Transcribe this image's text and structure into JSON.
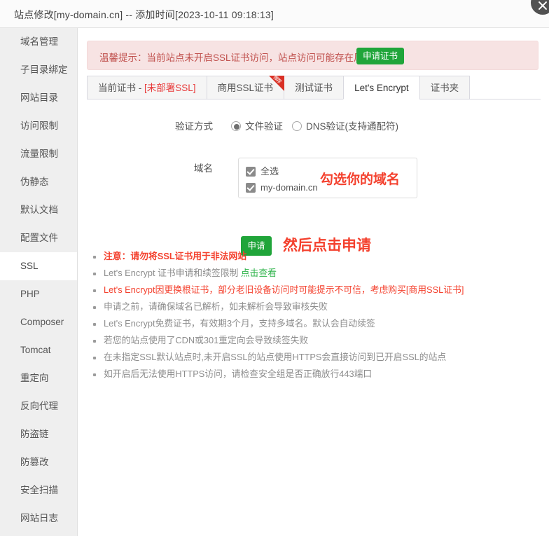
{
  "window": {
    "title": "站点修改[my-domain.cn] -- 添加时间[2023-10-11 09:18:13]",
    "close_label": "×"
  },
  "sidebar": {
    "items": [
      {
        "label": "域名管理",
        "active": false
      },
      {
        "label": "子目录绑定",
        "active": false
      },
      {
        "label": "网站目录",
        "active": false
      },
      {
        "label": "访问限制",
        "active": false
      },
      {
        "label": "流量限制",
        "active": false
      },
      {
        "label": "伪静态",
        "active": false
      },
      {
        "label": "默认文档",
        "active": false
      },
      {
        "label": "配置文件",
        "active": false
      },
      {
        "label": "SSL",
        "active": true
      },
      {
        "label": "PHP",
        "active": false
      },
      {
        "label": "Composer",
        "active": false
      },
      {
        "label": "Tomcat",
        "active": false
      },
      {
        "label": "重定向",
        "active": false
      },
      {
        "label": "反向代理",
        "active": false
      },
      {
        "label": "防盗链",
        "active": false
      },
      {
        "label": "防篡改",
        "active": false
      },
      {
        "label": "安全扫描",
        "active": false
      },
      {
        "label": "网站日志",
        "active": false
      }
    ]
  },
  "notice": {
    "text": "温馨提示：当前站点未开启SSL证书访问，站点访问可能存在风险。",
    "button_label": "申请证书",
    "bg_color": "#f7e3e3",
    "text_color": "#c0504d",
    "button_color": "#20a53a"
  },
  "tabs": [
    {
      "label": "当前证书 - ",
      "warn": "[未部署SSL]",
      "active": false,
      "ribbon": ""
    },
    {
      "label": "商用SSL证书",
      "warn": "",
      "active": false,
      "ribbon": "推荐"
    },
    {
      "label": "测试证书",
      "warn": "",
      "active": false,
      "ribbon": ""
    },
    {
      "label": "Let's Encrypt",
      "warn": "",
      "active": true,
      "ribbon": ""
    },
    {
      "label": "证书夹",
      "warn": "",
      "active": false,
      "ribbon": ""
    }
  ],
  "form": {
    "verify_label": "验证方式",
    "verify_options": [
      {
        "label": "文件验证",
        "selected": true
      },
      {
        "label": "DNS验证(支持通配符)",
        "selected": false
      }
    ],
    "domain_label": "域名",
    "domain_options": [
      {
        "label": "全选",
        "checked": true
      },
      {
        "label": "my-domain.cn",
        "checked": true
      }
    ],
    "apply_label": "申请"
  },
  "annotations": {
    "domain_hint": "勾选你的域名",
    "apply_hint": "然后点击申请",
    "color": "#f4412e"
  },
  "bullets": [
    {
      "text": "注意：请勿将SSL证书用于非法网站",
      "style": "red"
    },
    {
      "text": "Let's Encrypt 证书申请和续签限制 ",
      "style": "normal",
      "link": "点击查看"
    },
    {
      "text": "Let's Encrypt因更换根证书，部分老旧设备访问时可能提示不可信，考虑购买[商用SSL证书]",
      "style": "red-plain"
    },
    {
      "text": "申请之前，请确保域名已解析，如未解析会导致审核失败",
      "style": "normal"
    },
    {
      "text": "Let's Encrypt免费证书，有效期3个月，支持多域名。默认会自动续签",
      "style": "normal"
    },
    {
      "text": "若您的站点使用了CDN或301重定向会导致续签失败",
      "style": "normal"
    },
    {
      "text": "在未指定SSL默认站点时,未开启SSL的站点使用HTTPS会直接访问到已开启SSL的站点",
      "style": "normal"
    },
    {
      "text": "如开启后无法使用HTTPS访问，请检查安全组是否正确放行443端口",
      "style": "normal"
    }
  ]
}
